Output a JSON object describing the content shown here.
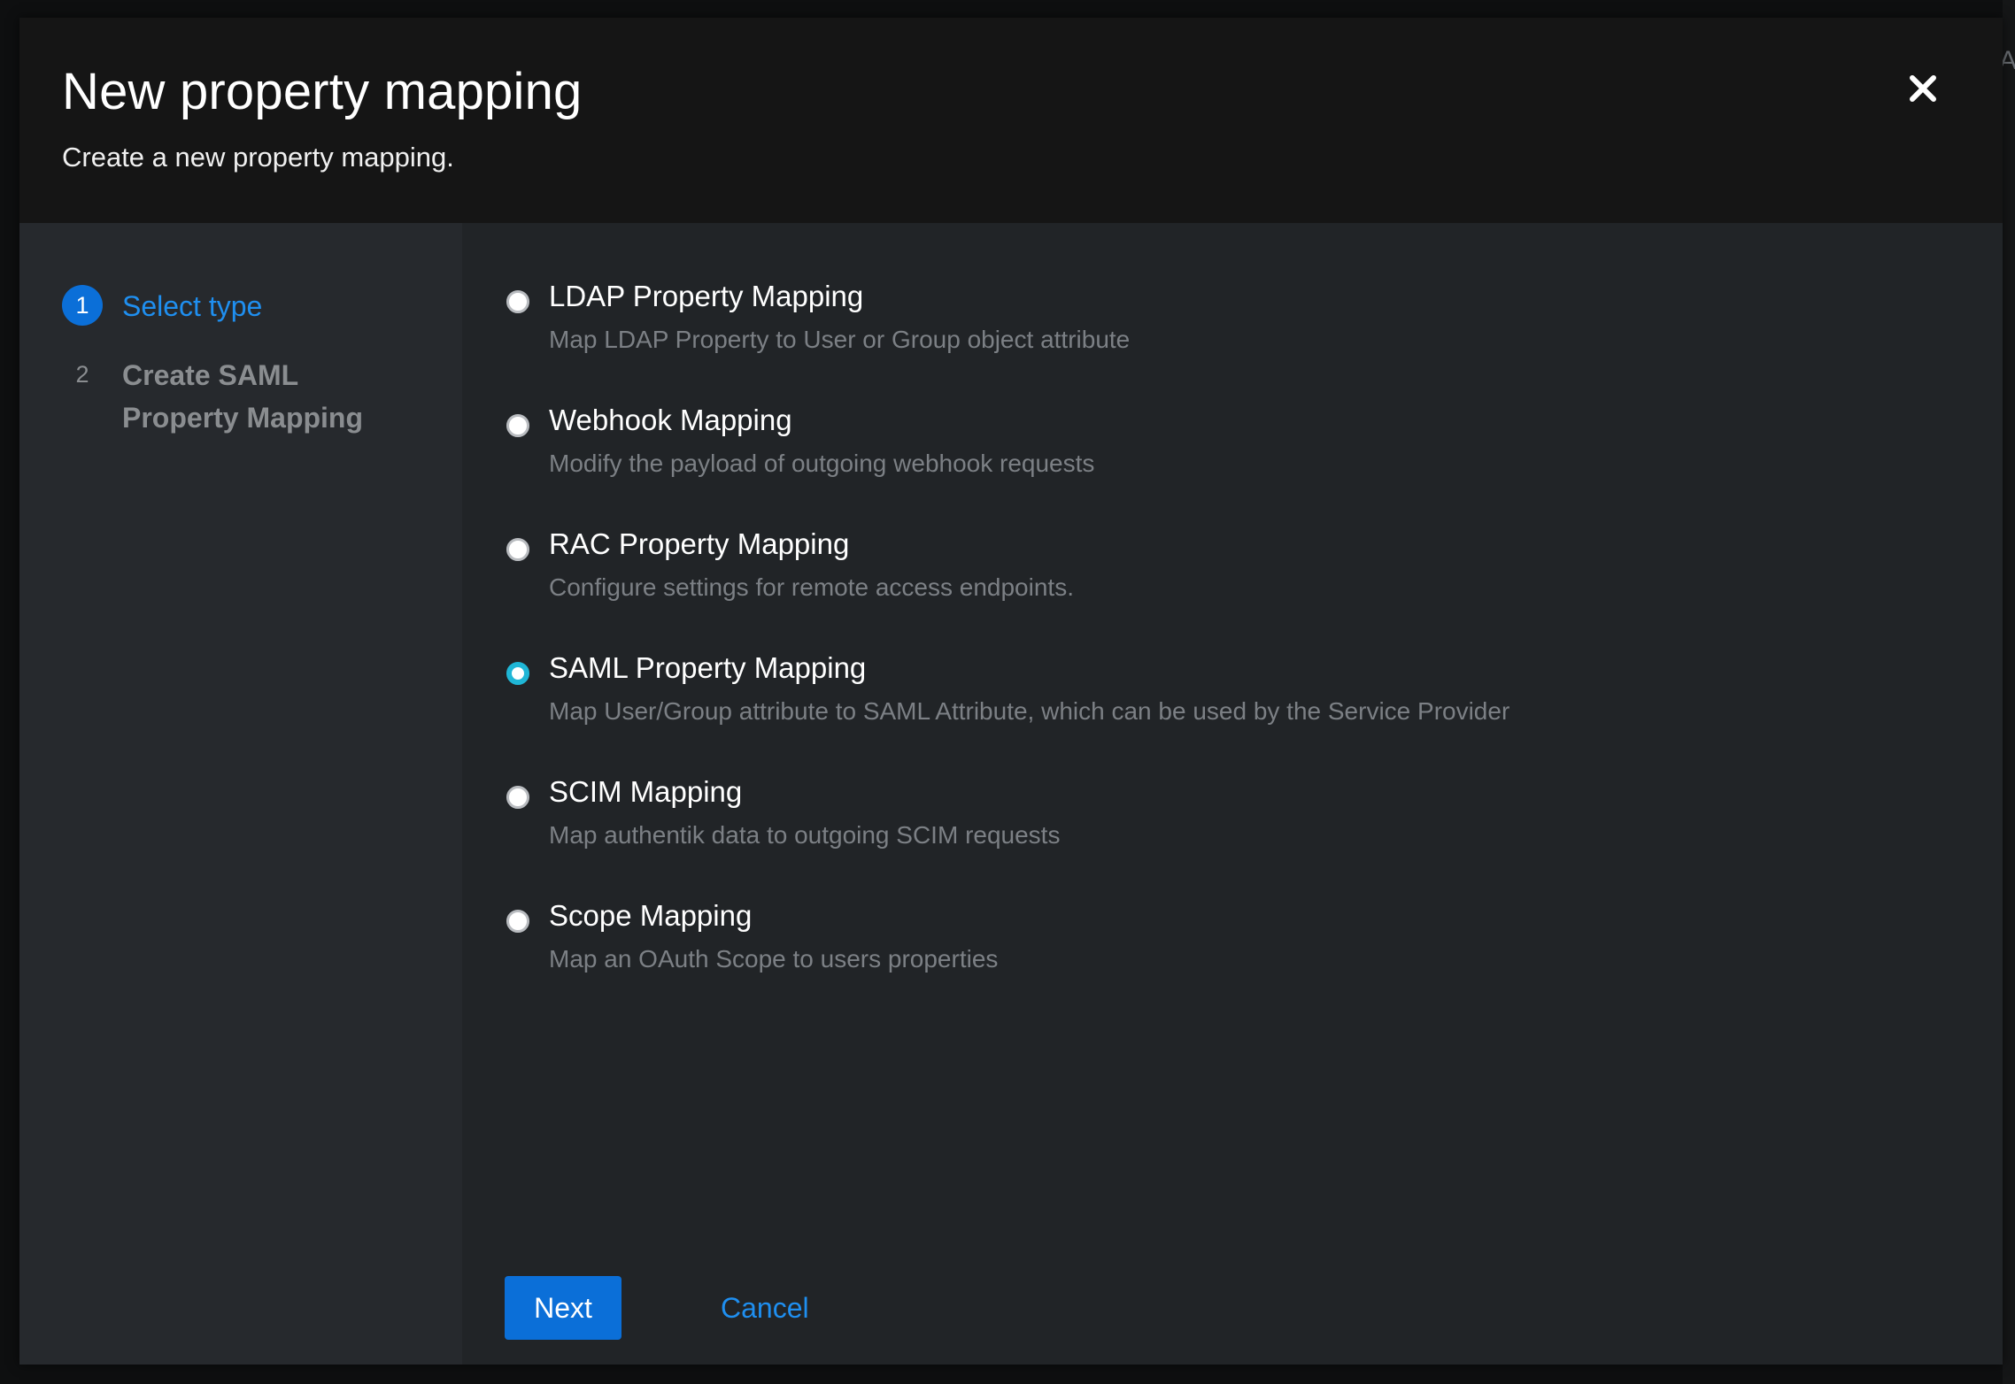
{
  "modal": {
    "title": "New property mapping",
    "subtitle": "Create a new property mapping.",
    "close_icon": "close-icon"
  },
  "steps": [
    {
      "number": "1",
      "label": "Select type",
      "state": "current"
    },
    {
      "number": "2",
      "label": "Create SAML Property Mapping",
      "state": "pending"
    }
  ],
  "options": [
    {
      "label": "LDAP Property Mapping",
      "description": "Map LDAP Property to User or Group object attribute",
      "checked": false
    },
    {
      "label": "Webhook Mapping",
      "description": "Modify the payload of outgoing webhook requests",
      "checked": false
    },
    {
      "label": "RAC Property Mapping",
      "description": "Configure settings for remote access endpoints.",
      "checked": false
    },
    {
      "label": "SAML Property Mapping",
      "description": "Map User/Group attribute to SAML Attribute, which can be used by the Service Provider",
      "checked": true
    },
    {
      "label": "SCIM Mapping",
      "description": "Map authentik data to outgoing SCIM requests",
      "checked": false
    },
    {
      "label": "Scope Mapping",
      "description": "Map an OAuth Scope to users properties",
      "checked": false
    }
  ],
  "footer": {
    "next_label": "Next",
    "cancel_label": "Cancel"
  },
  "background": {
    "edge_text": "A"
  },
  "colors": {
    "accent": "#0b6fd8",
    "link": "#1f8ff0",
    "radio_checked": "#1fb6d6",
    "header_bg": "#151515",
    "nav_bg": "#26292d",
    "content_bg": "#212427"
  }
}
